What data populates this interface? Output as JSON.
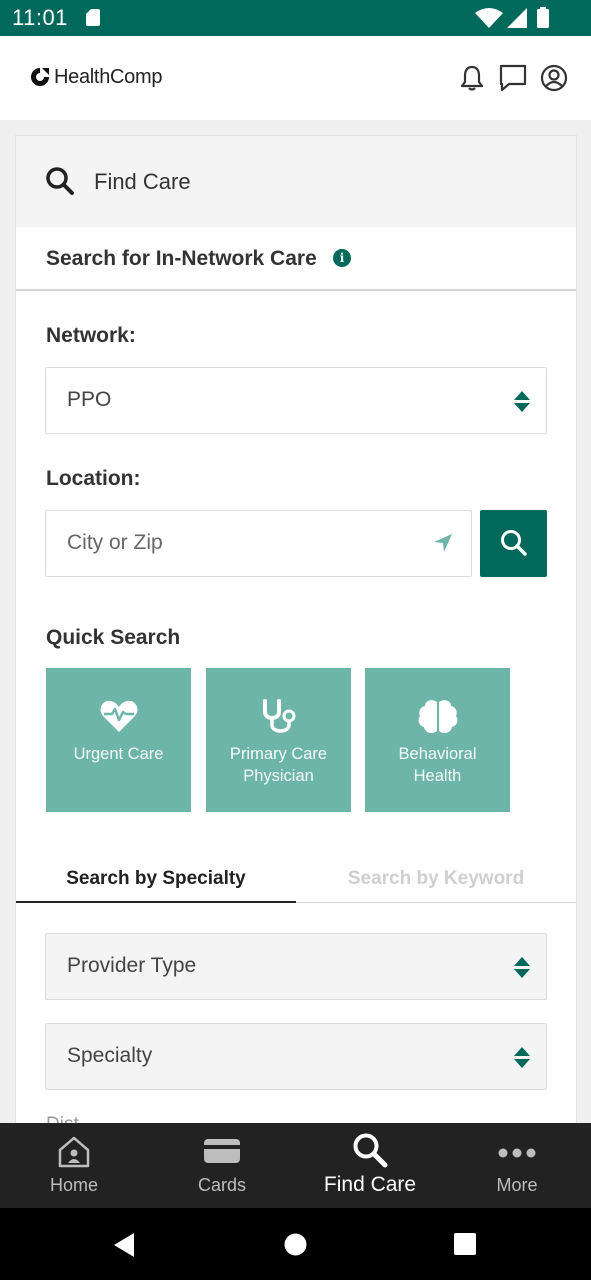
{
  "status_bar": {
    "time": "11:01"
  },
  "header": {
    "brand": "HealthComp"
  },
  "find_care": {
    "title": "Find Care",
    "section_title": "Search for In-Network Care",
    "network_label": "Network:",
    "network_value": "PPO",
    "location_label": "Location:",
    "location_placeholder": "City or Zip",
    "quick_search_title": "Quick Search",
    "quick_search": [
      {
        "line1": "Urgent Care",
        "line2": ""
      },
      {
        "line1": "Primary Care",
        "line2": "Physician"
      },
      {
        "line1": "Behavioral",
        "line2": "Health"
      }
    ],
    "tabs": {
      "specialty": "Search by Specialty",
      "keyword": "Search by Keyword"
    },
    "provider_type_placeholder": "Provider Type",
    "specialty_placeholder": "Specialty",
    "distance_label_partial": "Dist..."
  },
  "bottom_nav": [
    {
      "label": "Home",
      "icon": "home-icon"
    },
    {
      "label": "Cards",
      "icon": "card-icon"
    },
    {
      "label": "Find Care",
      "icon": "search-icon",
      "active": true
    },
    {
      "label": "More",
      "icon": "more-icon"
    }
  ],
  "colors": {
    "primary": "#00695c",
    "tile": "#6db5a8",
    "nav_bg": "#222222"
  }
}
